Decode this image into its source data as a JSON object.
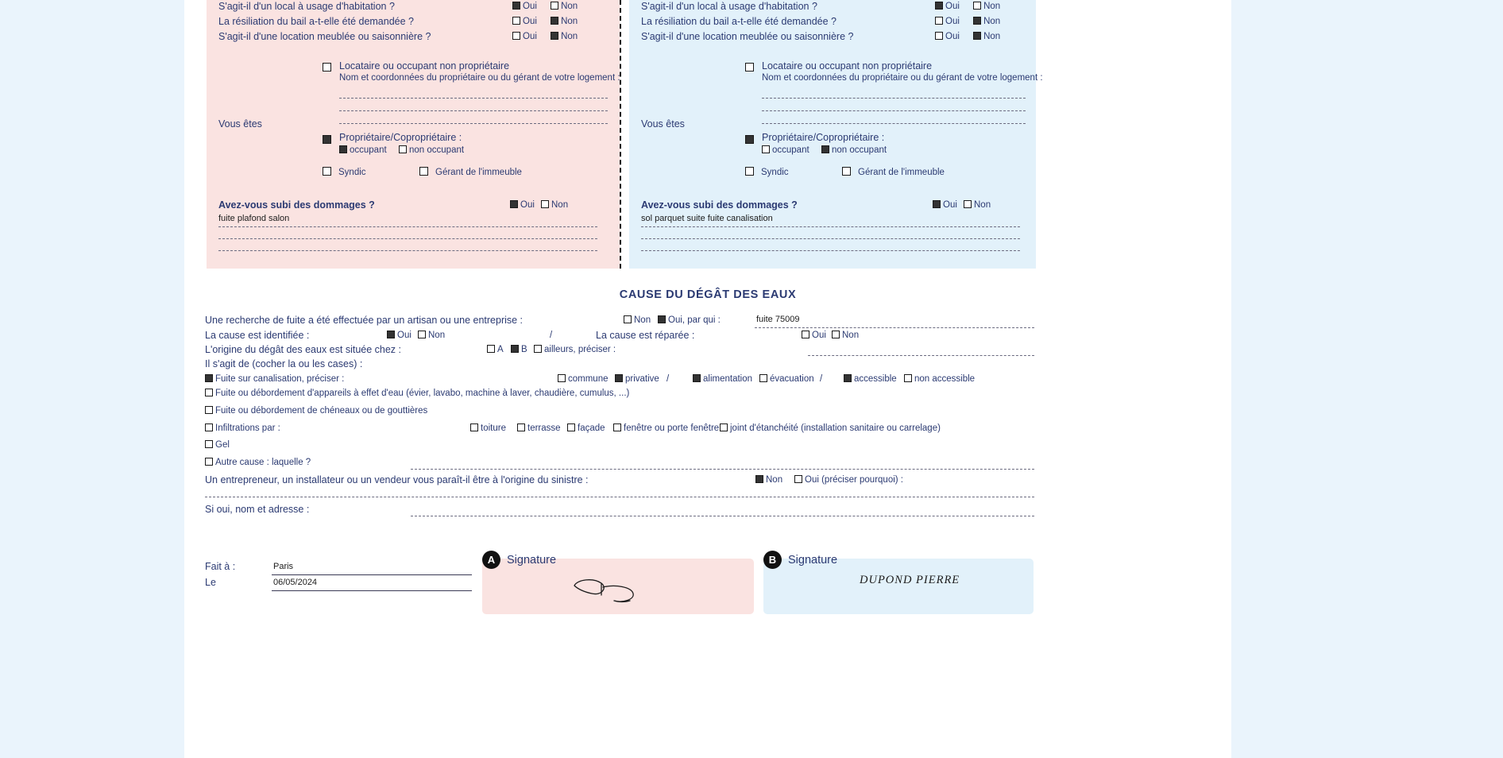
{
  "panels": {
    "a": {
      "side_label": "A",
      "questions": [
        {
          "text": "S'agit-il d'un local à usage d'habitation ?",
          "oui": true,
          "non": false
        },
        {
          "text": "La résiliation du bail a-t-elle été demandée ?",
          "oui": false,
          "non": true
        },
        {
          "text": "S'agit-il d'une location meublée ou saisonnière ?",
          "oui": false,
          "non": true
        }
      ],
      "vous_etes_label": "Vous êtes",
      "locataire": {
        "label": "Locataire ou occupant non propriétaire",
        "checked": false
      },
      "locataire_sub": "Nom et coordonnées du propriétaire ou du gérant de votre logement :",
      "proprietaire": {
        "label": "Propriétaire/Copropriétaire :",
        "checked": true
      },
      "occupant": {
        "label": "occupant",
        "checked": true
      },
      "non_occupant": {
        "label": "non occupant",
        "checked": false
      },
      "syndic": {
        "label": "Syndic",
        "checked": false
      },
      "gerant": {
        "label": "Gérant de l'immeuble",
        "checked": false
      },
      "dommages_label": "Avez-vous subi des dommages ?",
      "dommages_oui": {
        "label": "Oui",
        "checked": true
      },
      "dommages_non": {
        "label": "Non",
        "checked": false
      },
      "dommages_text": "fuite plafond salon"
    },
    "b": {
      "side_label": "B",
      "questions": [
        {
          "text": "S'agit-il d'un local à usage d'habitation ?",
          "oui": true,
          "non": false
        },
        {
          "text": "La résiliation du bail a-t-elle été demandée ?",
          "oui": false,
          "non": true
        },
        {
          "text": "S'agit-il d'une location meublée ou saisonnière ?",
          "oui": false,
          "non": true
        }
      ],
      "vous_etes_label": "Vous êtes",
      "locataire": {
        "label": "Locataire ou occupant non propriétaire",
        "checked": false
      },
      "locataire_sub": "Nom et coordonnées du propriétaire ou du gérant de votre logement :",
      "proprietaire": {
        "label": "Propriétaire/Copropriétaire :",
        "checked": true
      },
      "occupant": {
        "label": "occupant",
        "checked": false
      },
      "non_occupant": {
        "label": "non occupant",
        "checked": true
      },
      "syndic": {
        "label": "Syndic",
        "checked": false
      },
      "gerant": {
        "label": "Gérant de l'immeuble",
        "checked": false
      },
      "dommages_label": "Avez-vous subi des dommages ?",
      "dommages_oui": {
        "label": "Oui",
        "checked": true
      },
      "dommages_non": {
        "label": "Non",
        "checked": false
      },
      "dommages_text": "sol parquet suite fuite canalisation"
    },
    "shared": {
      "oui": "Oui",
      "non": "Non"
    }
  },
  "cause": {
    "title": "CAUSE DU DÉGÂT DES EAUX",
    "recherche": {
      "label": "Une recherche de fuite a été effectuée par un artisan ou une entreprise :",
      "non": {
        "label": "Non",
        "checked": false
      },
      "oui_par_qui": {
        "label": "Oui, par qui :",
        "checked": true
      },
      "value": "fuite 75009"
    },
    "identifiee": {
      "label": "La cause est identifiée :",
      "oui": {
        "label": "Oui",
        "checked": true
      },
      "non": {
        "label": "Non",
        "checked": false
      }
    },
    "separator": "/",
    "reparee": {
      "label": "La cause est réparée :",
      "oui": {
        "label": "Oui",
        "checked": false
      },
      "non": {
        "label": "Non",
        "checked": false
      }
    },
    "origine": {
      "label": "L'origine du dégât des eaux est située chez :",
      "a": {
        "label": "A",
        "checked": false
      },
      "b": {
        "label": "B",
        "checked": true
      },
      "ailleurs": {
        "label": "ailleurs, préciser :",
        "checked": false
      },
      "ailleurs_value": ""
    },
    "il_sagit_de": "Il s'agit de (cocher la ou les cases) :",
    "fuite_canalisation": {
      "label": "Fuite sur canalisation, préciser :",
      "checked": true,
      "commune": {
        "label": "commune",
        "checked": false
      },
      "privative": {
        "label": "privative",
        "checked": true
      },
      "sep1": "/",
      "alimentation": {
        "label": "alimentation",
        "checked": true
      },
      "evacuation": {
        "label": "évacuation",
        "checked": false
      },
      "sep2": "/",
      "accessible": {
        "label": "accessible",
        "checked": true
      },
      "non_accessible": {
        "label": "non accessible",
        "checked": false
      }
    },
    "debordement_appareils": {
      "label": "Fuite ou débordement d'appareils à effet d'eau (évier, lavabo, machine à laver, chaudière, cumulus, ...)",
      "checked": false
    },
    "cheneaux": {
      "label": "Fuite ou débordement de chéneaux ou de gouttières",
      "checked": false
    },
    "infiltrations": {
      "label": "Infiltrations par :",
      "checked": false,
      "options": [
        {
          "label": "toiture",
          "checked": false
        },
        {
          "label": "terrasse",
          "checked": false
        },
        {
          "label": "façade",
          "checked": false
        },
        {
          "label": "fenêtre ou porte fenêtre",
          "checked": false
        },
        {
          "label": "joint d'étanchéité (installation sanitaire ou carrelage)",
          "checked": false
        }
      ]
    },
    "gel": {
      "label": "Gel",
      "checked": false
    },
    "autre_cause": {
      "label": "Autre cause : laquelle ?",
      "checked": false,
      "value": ""
    },
    "entrepreneur": {
      "label": "Un entrepreneur, un installateur ou un vendeur vous paraît-il être à l'origine du sinistre :",
      "non": {
        "label": "Non",
        "checked": true
      },
      "oui": {
        "label": "Oui (préciser pourquoi) :",
        "checked": false
      },
      "value": ""
    },
    "si_oui_nom": {
      "label": "Si oui, nom et adresse :",
      "value": ""
    }
  },
  "footer": {
    "fait_a_label": "Fait à :",
    "fait_a_value": "Paris",
    "le_label": "Le",
    "le_value": "06/05/2024",
    "signature_label": "Signature",
    "signature_a_badge": "A",
    "signature_b_badge": "B",
    "signature_b_text": "DUPOND PIERRE"
  },
  "colors": {
    "panel_a": "#fae3e1",
    "panel_b": "#e2f1fa",
    "text": "#2b3a72",
    "page_bg": "#eaf4fc",
    "sheet": "#ffffff",
    "checkbox_on": "#333333"
  }
}
